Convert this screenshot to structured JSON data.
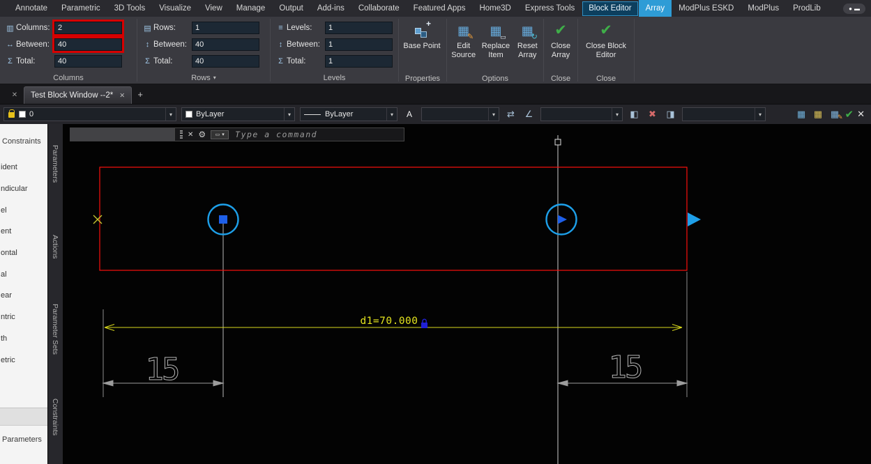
{
  "menubar": {
    "items": [
      "Annotate",
      "Parametric",
      "3D Tools",
      "Visualize",
      "View",
      "Manage",
      "Output",
      "Add-ins",
      "Collaborate",
      "Featured Apps",
      "Home3D",
      "Express Tools",
      "Block Editor",
      "Array",
      "ModPlus ESKD",
      "ModPlus",
      "ProdLib"
    ]
  },
  "ribbon": {
    "columns": {
      "title": "Columns",
      "fields": [
        {
          "label": "Columns:",
          "value": "2"
        },
        {
          "label": "Between:",
          "value": "40"
        },
        {
          "label": "Total:",
          "value": "40"
        }
      ]
    },
    "rows": {
      "title": "Rows",
      "fields": [
        {
          "label": "Rows:",
          "value": "1"
        },
        {
          "label": "Between:",
          "value": "40"
        },
        {
          "label": "Total:",
          "value": "40"
        }
      ]
    },
    "levels": {
      "title": "Levels",
      "fields": [
        {
          "label": "Levels:",
          "value": "1"
        },
        {
          "label": "Between:",
          "value": "1"
        },
        {
          "label": "Total:",
          "value": "1"
        }
      ]
    },
    "properties": {
      "title": "Properties",
      "base_point_label": "Base Point"
    },
    "options": {
      "title": "Options",
      "edit_source_label": "Edit Source",
      "replace_item_label": "Replace Item",
      "reset_array_label": "Reset Array"
    },
    "close_array": {
      "title": "Close",
      "label": "Close Array"
    },
    "close_block_editor": {
      "title": "Close",
      "label": "Close Block Editor"
    }
  },
  "file_tabs": {
    "active_tab_label": "Test Block Window --2*"
  },
  "properties_toolbar": {
    "layer_value": "0",
    "color_value": "ByLayer",
    "linetype_value": "ByLayer",
    "text_style_letter": "A"
  },
  "command_line": {
    "placeholder": "Type a command"
  },
  "palette": {
    "header": "Constraints",
    "items": [
      "ident",
      "ndicular",
      "el",
      "ent",
      "ontal",
      "al",
      "ear",
      "ntric",
      "th",
      "etric"
    ],
    "footer": "Parameters"
  },
  "side_tabs": [
    "Parameters",
    "Actions",
    "Parameter Sets",
    "Constraints"
  ],
  "canvas": {
    "d1_label": "d1=70.000",
    "dim_left_label": "15",
    "dim_right_label": "15"
  },
  "colors": {
    "array_tab_active": "#2e9cd6",
    "block_editor_tab": "#0d3f5e",
    "highlight_box_red": "#d60000",
    "grip_blue": "#1e5fe8",
    "circle_blue": "#1d9fe8",
    "dimension_yellow": "#dede20",
    "outline_red": "#fb0f0c",
    "close_check_green": "#3fae49"
  },
  "icons": {
    "dropdown": "▾",
    "close": "✕",
    "plus": "+",
    "check": "✔",
    "pencil": "✎",
    "grid": "▦",
    "columns": "▥",
    "rows": "▤",
    "levels": "≡",
    "between_h": "↔",
    "between_v": "↕",
    "total": "Σ",
    "reset": "↻",
    "swap": "⇄",
    "angle": "∠",
    "half_left": "◧",
    "half_right": "◨",
    "cross": "✖",
    "box": "▭",
    "gear": "⚙",
    "bullet": "●",
    "dash": "▬"
  }
}
